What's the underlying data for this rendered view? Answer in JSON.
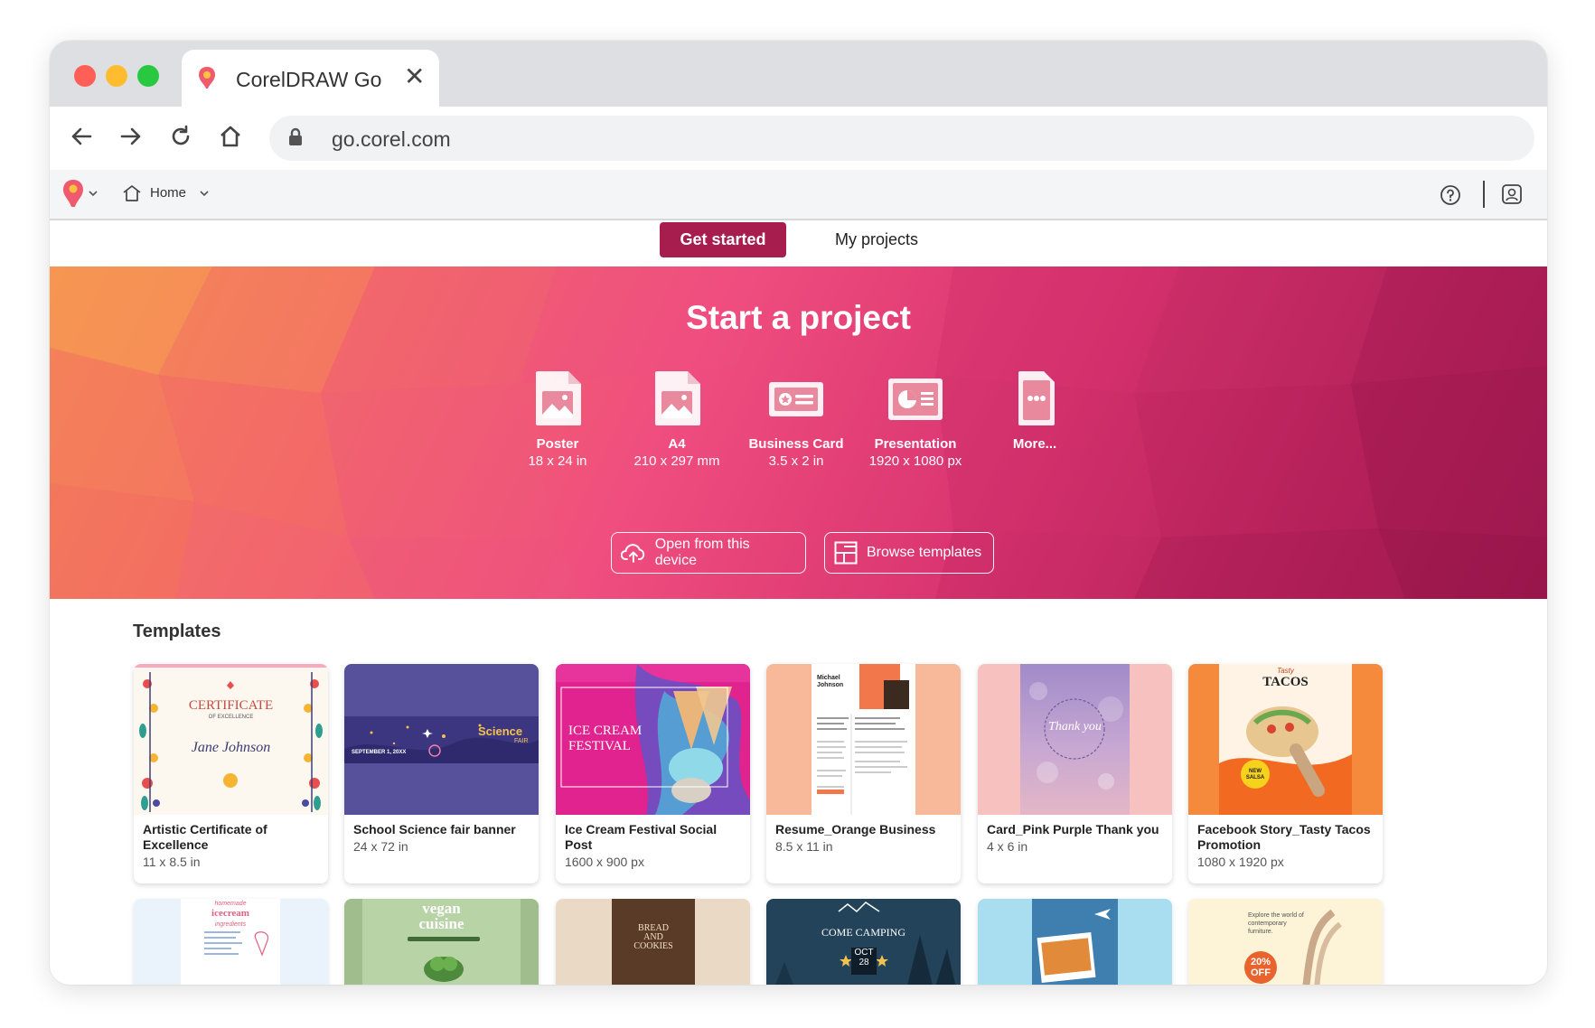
{
  "browser": {
    "tab_title": "CorelDRAW Go",
    "url": "go.corel.com"
  },
  "app": {
    "home_label": "Home"
  },
  "page_tabs": {
    "get_started": "Get started",
    "my_projects": "My projects"
  },
  "hero": {
    "title": "Start a project",
    "presets": [
      {
        "label": "Poster",
        "size": "18 x 24 in",
        "icon": "image-file-icon"
      },
      {
        "label": "A4",
        "size": "210 x 297 mm",
        "icon": "image-file-icon"
      },
      {
        "label": "Business Card",
        "size": "3.5 x 2 in",
        "icon": "business-card-icon"
      },
      {
        "label": "Presentation",
        "size": "1920 x 1080 px",
        "icon": "presentation-icon"
      },
      {
        "label": "More...",
        "size": "",
        "icon": "more-icon"
      }
    ],
    "open_device": "Open from this device",
    "browse_templates": "Browse templates"
  },
  "templates": {
    "heading": "Templates",
    "cards": [
      {
        "name": "Artistic Certificate of Excellence",
        "size": "11 x 8.5 in"
      },
      {
        "name": "School Science fair banner",
        "size": "24 x 72 in"
      },
      {
        "name": "Ice Cream Festival Social Post",
        "size": "1600 x 900 px"
      },
      {
        "name": "Resume_Orange Business",
        "size": "8.5 x 11 in"
      },
      {
        "name": "Card_Pink Purple Thank you",
        "size": "4 x 6 in"
      },
      {
        "name": "Facebook Story_Tasty Tacos Promotion",
        "size": "1080 x 1920 px"
      }
    ],
    "thumb_text": {
      "certificate": "CERTIFICATE",
      "cert_sub": "OF EXCELLENCE",
      "cert_name": "Jane Johnson",
      "science": "Science",
      "science_fair": "FAIR",
      "science_date": "SEPTEMBER 1, 20XX",
      "icecream": "ICE CREAM",
      "festival": "FESTIVAL",
      "resume_name": "Michael Johnson",
      "thank_you": "Thank you",
      "tacos_brand": "Tasty",
      "tacos": "TACOS",
      "tacos_promo": "NEW SALSA",
      "homemade": "homemade",
      "icecream2": "icecream",
      "ingredients": "ingredients",
      "vegan": "vegan",
      "cuisine": "cuisine",
      "bread": "BREAD",
      "and": "AND",
      "cookies": "COOKIES",
      "come_camping": "COME CAMPING",
      "oct": "OCT",
      "day": "28",
      "explore": "Explore the world of contemporary furniture.",
      "off_pct": "20%",
      "off": "OFF"
    }
  },
  "colors": {
    "accent": "#a71d4d",
    "traffic_red": "#ff5f57",
    "traffic_yellow": "#febc2e",
    "traffic_green": "#28c840"
  }
}
